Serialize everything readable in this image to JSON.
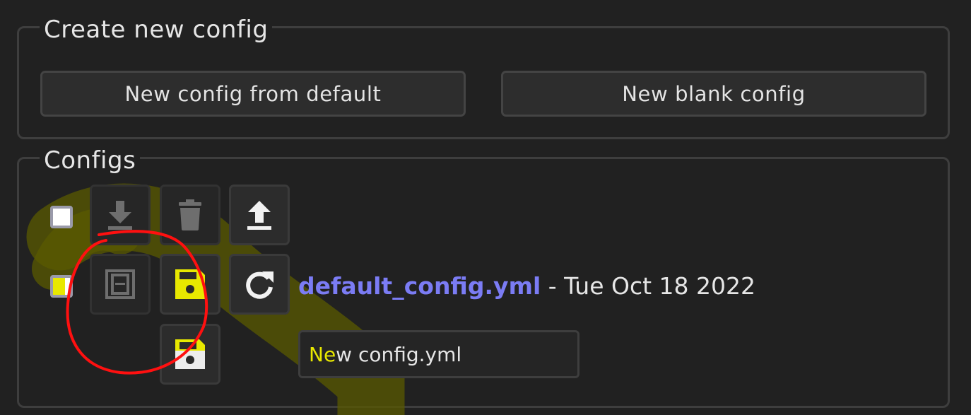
{
  "create_section": {
    "legend": "Create new config",
    "from_default_label": "New config from default",
    "blank_label": "New blank config"
  },
  "configs_section": {
    "legend": "Configs",
    "header_row": {
      "select_all_checked": false,
      "download_icon": "download-icon",
      "delete_icon": "trash-icon",
      "upload_icon": "upload-icon"
    },
    "config_row": {
      "name": "default_config.yml",
      "separator": " - ",
      "date": "Tue Oct 18 2022",
      "autoload_icon": "autoload-icon",
      "save_icon": "save-icon",
      "reload_icon": "reload-icon"
    },
    "new_config_row": {
      "save_icon": "save-icon",
      "input_value_highlight": "Ne",
      "input_value_rest": "w config.yml"
    }
  },
  "annotations": {
    "highlighter_color": "#6e6e00",
    "circle_color": "#ff0000"
  },
  "colors": {
    "accent_link": "#7b7cf4",
    "save_yellow": "#e8e800",
    "background": "#212121"
  }
}
